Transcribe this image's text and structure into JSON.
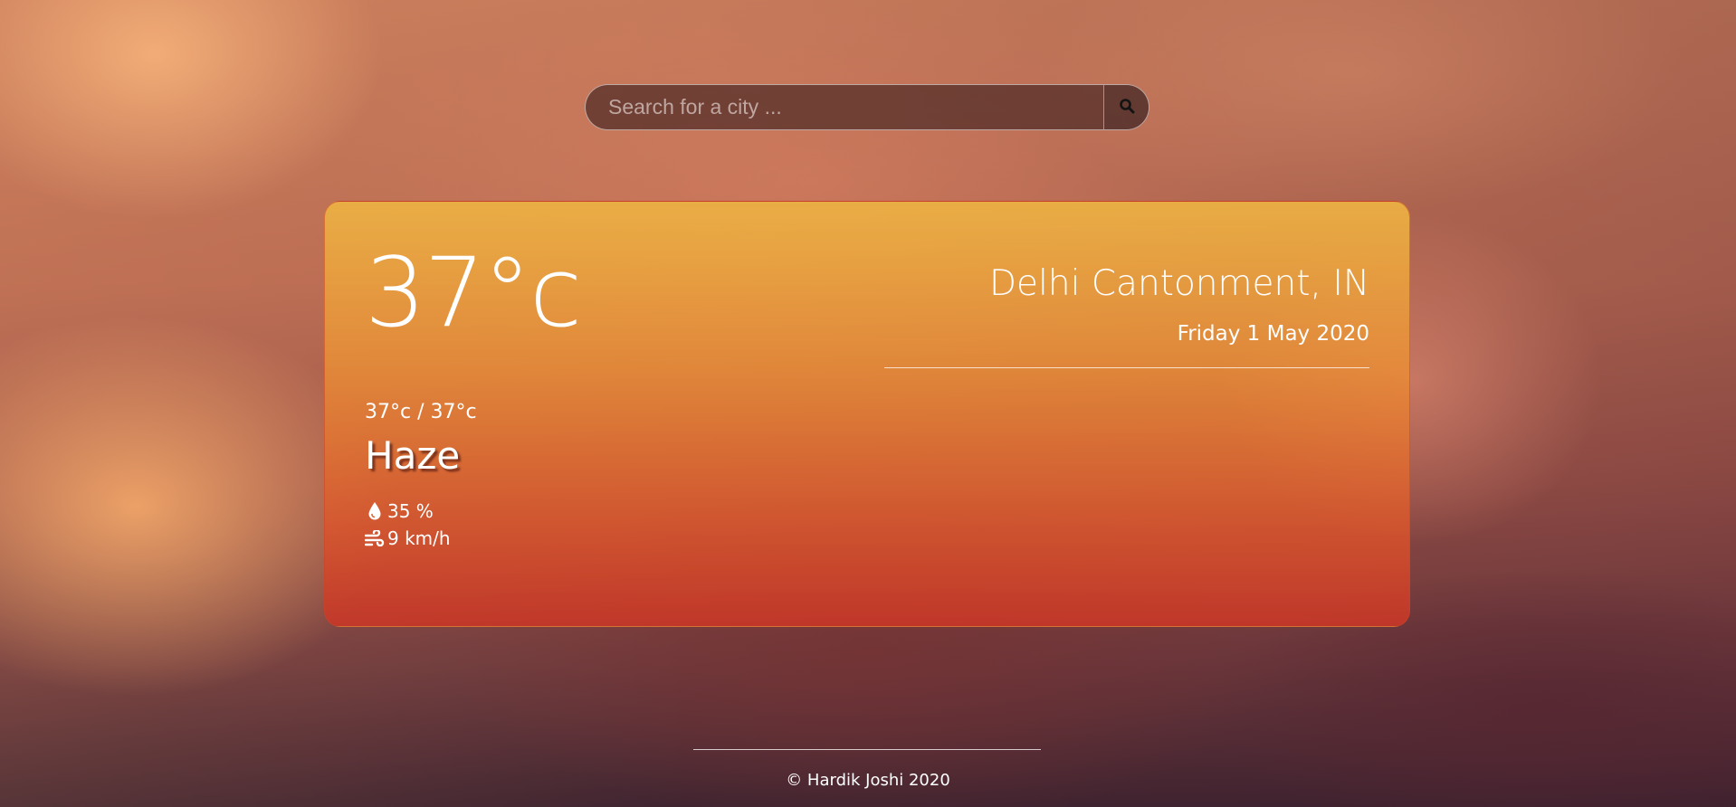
{
  "search": {
    "placeholder": "Search for a city ...",
    "value": "",
    "button_icon": "search-icon"
  },
  "weather": {
    "temperature": "37°c",
    "location": "Delhi Cantonment, IN",
    "date": "Friday 1 May 2020",
    "min_max": "37°c / 37°c",
    "condition": "Haze",
    "humidity": "35 %",
    "humidity_icon": "droplet-icon",
    "wind": "9 km/h",
    "wind_icon": "wind-icon"
  },
  "footer": {
    "copyright": "© Hardik Joshi 2020"
  },
  "colors": {
    "card_top": "#ecb244",
    "card_bottom": "#c83728",
    "text": "#ffffff"
  }
}
